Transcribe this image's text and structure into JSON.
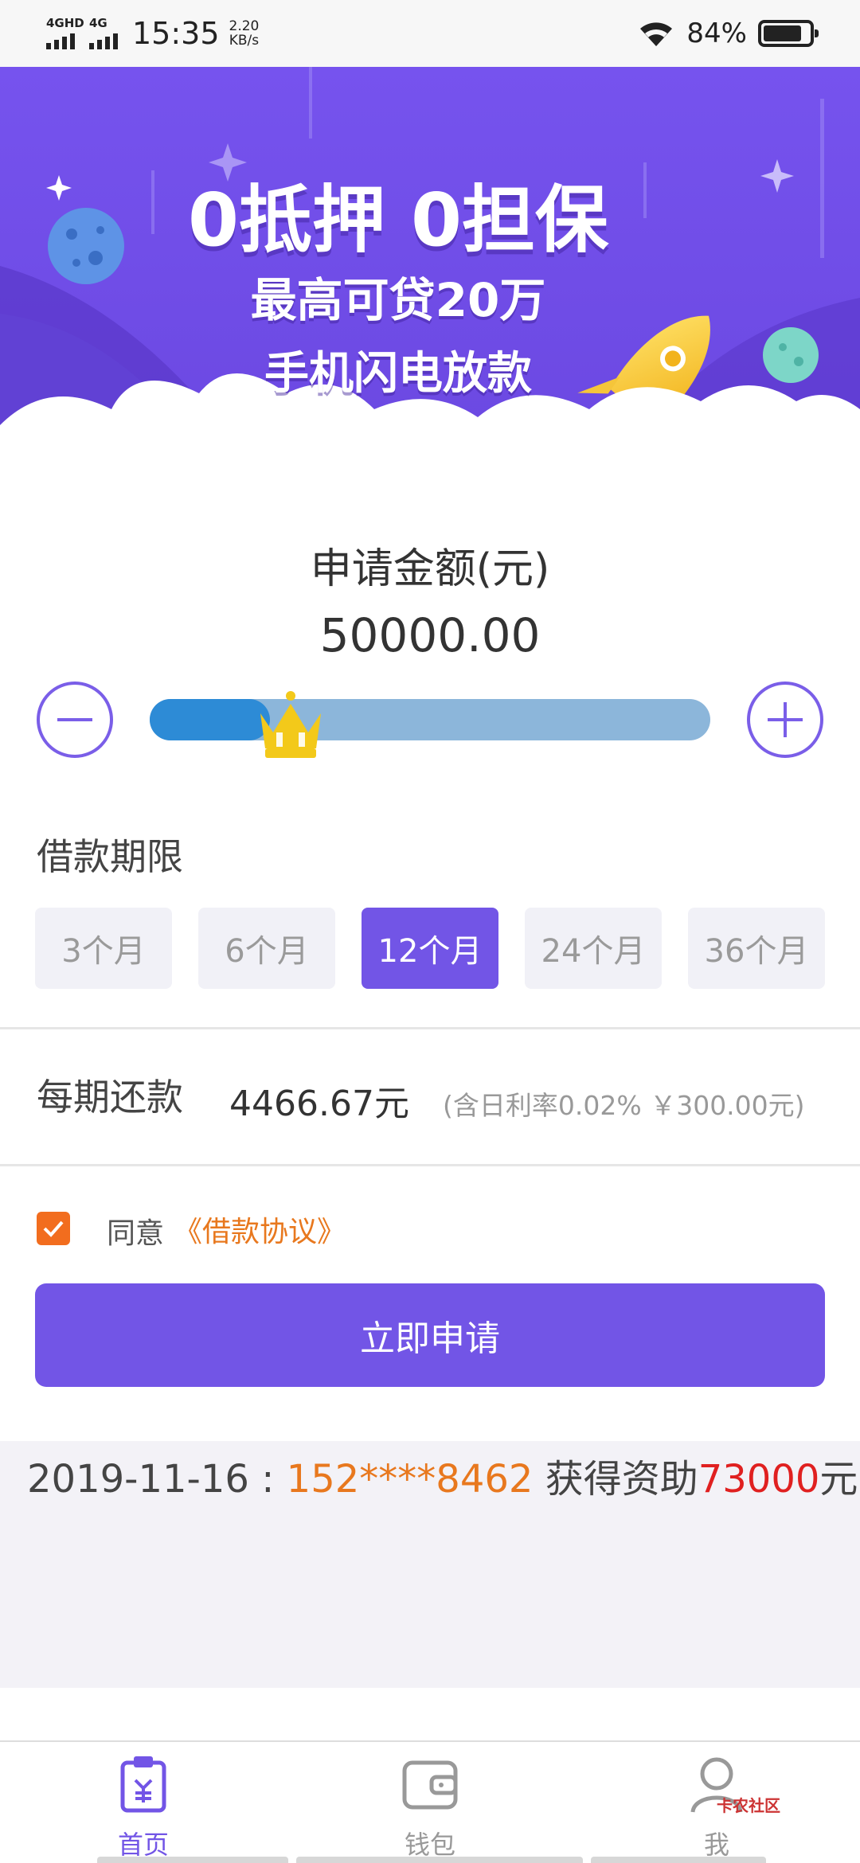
{
  "status_bar": {
    "network1": "4GHD",
    "network2": "4G",
    "time": "15:35",
    "speed_value": "2.20",
    "speed_unit": "KB/s",
    "battery_percent": "84%",
    "battery_level": 0.84
  },
  "banner": {
    "line1": "0抵押 0担保",
    "line2": "最高可贷20万",
    "line3": "手机闪电放款"
  },
  "amount": {
    "label": "申请金额(元)",
    "value": "50000.00",
    "slider_fraction": 0.2
  },
  "term": {
    "label": "借款期限",
    "options": [
      "3个月",
      "6个月",
      "12个月",
      "24个月",
      "36个月"
    ],
    "selected_index": 2
  },
  "repayment": {
    "label": "每期还款",
    "value": "4466.67元",
    "note": "(含日利率0.02% ￥300.00元)"
  },
  "agreement": {
    "checked": true,
    "text": "同意",
    "link": "《借款协议》"
  },
  "apply_button": "立即申请",
  "notice": {
    "date": "2019-11-16 :",
    "phone": "152****8462",
    "middle": "获得资助",
    "amount": "73000",
    "suffix": "元!"
  },
  "tabbar": {
    "items": [
      {
        "label": "首页",
        "icon": "clipboard-yen-icon",
        "active": true
      },
      {
        "label": "钱包",
        "icon": "wallet-icon",
        "active": false
      },
      {
        "label": "我",
        "icon": "user-icon",
        "active": false
      }
    ]
  },
  "watermark": "卡农社区",
  "colors": {
    "primary": "#7255e6",
    "orange": "#e8781e",
    "red": "#e02020",
    "slider_fill": "#2d8bd6",
    "slider_track": "#8cb6da"
  }
}
